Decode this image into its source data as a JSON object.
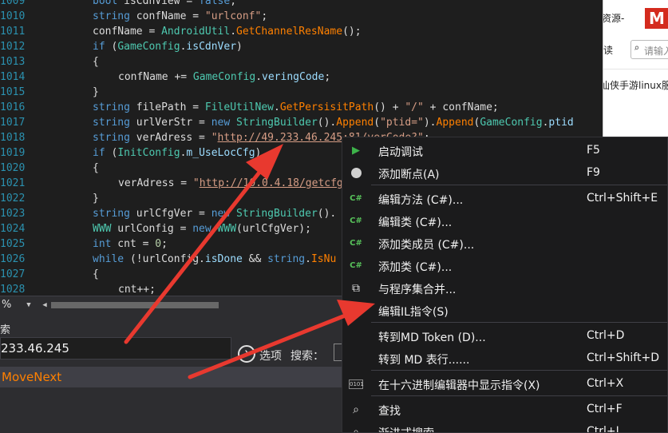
{
  "editor": {
    "lines": [
      {
        "n": "1009",
        "indent": 0,
        "tokens": [
          [
            "kw",
            "bool"
          ],
          [
            "tx",
            " isCdnView = "
          ],
          [
            "kw",
            "false"
          ],
          [
            "tx",
            ";"
          ]
        ]
      },
      {
        "n": "1010",
        "indent": 0,
        "tokens": [
          [
            "kw",
            "string"
          ],
          [
            "tx",
            " confName = "
          ],
          [
            "str",
            "\"urlconf\""
          ],
          [
            "tx",
            ";"
          ]
        ]
      },
      {
        "n": "1011",
        "indent": 0,
        "tokens": [
          [
            "tx",
            "confName = "
          ],
          [
            "ty",
            "AndroidUtil"
          ],
          [
            "tx",
            "."
          ],
          [
            "mt",
            "GetChannelResName"
          ],
          [
            "tx",
            "();"
          ]
        ]
      },
      {
        "n": "1012",
        "indent": 0,
        "tokens": [
          [
            "kw",
            "if"
          ],
          [
            "tx",
            " ("
          ],
          [
            "ty",
            "GameConfig"
          ],
          [
            "tx",
            "."
          ],
          [
            "fld",
            "isCdnVer"
          ],
          [
            "tx",
            ")"
          ]
        ]
      },
      {
        "n": "1013",
        "indent": 0,
        "tokens": [
          [
            "tx",
            "{"
          ]
        ]
      },
      {
        "n": "1014",
        "indent": 1,
        "tokens": [
          [
            "tx",
            "confName += "
          ],
          [
            "ty",
            "GameConfig"
          ],
          [
            "tx",
            "."
          ],
          [
            "fld",
            "veringCode"
          ],
          [
            "tx",
            ";"
          ]
        ]
      },
      {
        "n": "1015",
        "indent": 0,
        "tokens": [
          [
            "tx",
            "}"
          ]
        ]
      },
      {
        "n": "1016",
        "indent": 0,
        "tokens": [
          [
            "kw",
            "string"
          ],
          [
            "tx",
            " filePath = "
          ],
          [
            "ty",
            "FileUtilNew"
          ],
          [
            "tx",
            "."
          ],
          [
            "mt",
            "GetPersisitPath"
          ],
          [
            "tx",
            "() + "
          ],
          [
            "str",
            "\"/\""
          ],
          [
            "tx",
            " + confName;"
          ]
        ]
      },
      {
        "n": "1017",
        "indent": 0,
        "tokens": [
          [
            "kw",
            "string"
          ],
          [
            "tx",
            " urlVerStr = "
          ],
          [
            "kw",
            "new"
          ],
          [
            "tx",
            " "
          ],
          [
            "ty",
            "StringBuilder"
          ],
          [
            "tx",
            "()."
          ],
          [
            "mt",
            "Append"
          ],
          [
            "tx",
            "("
          ],
          [
            "str",
            "\"ptid=\""
          ],
          [
            "tx",
            ")."
          ],
          [
            "mt",
            "Append"
          ],
          [
            "tx",
            "("
          ],
          [
            "ty",
            "GameConfig"
          ],
          [
            "tx",
            "."
          ],
          [
            "fld",
            "ptid"
          ]
        ]
      },
      {
        "n": "1018",
        "indent": 0,
        "tokens": [
          [
            "kw",
            "string"
          ],
          [
            "tx",
            " verAdress = "
          ],
          [
            "str",
            "\""
          ],
          [
            "url",
            "http://49.233.46.245:81/verCode?"
          ],
          [
            "str",
            "\""
          ],
          [
            "tx",
            ";"
          ]
        ]
      },
      {
        "n": "1019",
        "indent": 0,
        "tokens": [
          [
            "kw",
            "if"
          ],
          [
            "tx",
            " ("
          ],
          [
            "ty",
            "InitConfig"
          ],
          [
            "tx",
            "."
          ],
          [
            "fld",
            "m_UseLocCfg"
          ],
          [
            "tx",
            ")"
          ]
        ]
      },
      {
        "n": "1020",
        "indent": 0,
        "tokens": [
          [
            "tx",
            "{"
          ]
        ]
      },
      {
        "n": "1021",
        "indent": 1,
        "tokens": [
          [
            "tx",
            "verAdress = "
          ],
          [
            "str",
            "\""
          ],
          [
            "url",
            "http://10.0.4.18/getcfg"
          ]
        ]
      },
      {
        "n": "1022",
        "indent": 0,
        "tokens": [
          [
            "tx",
            "}"
          ]
        ]
      },
      {
        "n": "1023",
        "indent": 0,
        "tokens": [
          [
            "kw",
            "string"
          ],
          [
            "tx",
            " urlCfgVer = "
          ],
          [
            "kw",
            "new"
          ],
          [
            "tx",
            " "
          ],
          [
            "ty",
            "StringBuilder"
          ],
          [
            "tx",
            "()."
          ]
        ]
      },
      {
        "n": "1024",
        "indent": 0,
        "tokens": [
          [
            "ty",
            "WWW"
          ],
          [
            "tx",
            " urlConfig = "
          ],
          [
            "kw",
            "new"
          ],
          [
            "tx",
            " "
          ],
          [
            "ty",
            "WWW"
          ],
          [
            "tx",
            "(urlCfgVer);"
          ]
        ]
      },
      {
        "n": "1025",
        "indent": 0,
        "tokens": [
          [
            "kw",
            "int"
          ],
          [
            "tx",
            " cnt = "
          ],
          [
            "num",
            "0"
          ],
          [
            "tx",
            ";"
          ]
        ]
      },
      {
        "n": "1026",
        "indent": 0,
        "tokens": [
          [
            "kw",
            "while"
          ],
          [
            "tx",
            " (!urlConfig."
          ],
          [
            "fld",
            "isDone"
          ],
          [
            "tx",
            " && "
          ],
          [
            "kw",
            "string"
          ],
          [
            "tx",
            "."
          ],
          [
            "mt",
            "IsNu"
          ]
        ]
      },
      {
        "n": "1027",
        "indent": 0,
        "tokens": [
          [
            "tx",
            "{"
          ]
        ]
      },
      {
        "n": "1028",
        "indent": 1,
        "tokens": [
          [
            "tx",
            "cnt++;"
          ]
        ]
      }
    ]
  },
  "browser": {
    "title_fragment": "资源-",
    "logo": "M",
    "read_label": "读",
    "search_placeholder": "请输入",
    "article_fragment": "仙侠手游linux服"
  },
  "scrollbar": {
    "zoom": "%"
  },
  "search": {
    "title": "索",
    "query": "233.46.245",
    "options_label": "选项",
    "search_type_label": "搜索：",
    "result": "MoveNext"
  },
  "context_menu": {
    "items": [
      {
        "icon": "play-icon",
        "label": "启动调试",
        "shortcut": "F5"
      },
      {
        "icon": "breakpoint-icon",
        "label": "添加断点(A)",
        "shortcut": "F9"
      },
      {
        "icon": "csharp-icon",
        "label": "编辑方法 (C#)...",
        "shortcut": "Ctrl+Shift+E"
      },
      {
        "icon": "csharp-icon",
        "label": "编辑类 (C#)...",
        "shortcut": ""
      },
      {
        "icon": "csharp-icon",
        "label": "添加类成员 (C#)...",
        "shortcut": ""
      },
      {
        "icon": "csharp-icon",
        "label": "添加类 (C#)...",
        "shortcut": ""
      },
      {
        "icon": "merge-icon",
        "label": "与程序集合并...",
        "shortcut": ""
      },
      {
        "icon": "il-edit-icon",
        "label": "编辑IL指令(S)",
        "shortcut": ""
      },
      {
        "icon": "",
        "label": "转到MD Token (D)...",
        "shortcut": "Ctrl+D"
      },
      {
        "icon": "",
        "label": "转到 MD 表行......",
        "shortcut": "Ctrl+Shift+D"
      },
      {
        "icon": "hex-icon",
        "label": "在十六进制编辑器中显示指令(X)",
        "shortcut": "Ctrl+X"
      },
      {
        "icon": "search-icon",
        "label": "查找",
        "shortcut": "Ctrl+F"
      },
      {
        "icon": "search-icon",
        "label": "渐进式搜索",
        "shortcut": "Ctrl+I"
      }
    ],
    "hex_icon_text": "0101"
  },
  "colors": {
    "editor_bg": "#1e1e1e",
    "line_number": "#2b91af",
    "keyword": "#569cd6",
    "type": "#4ec9b0",
    "method": "#ff8000",
    "string": "#d69d85",
    "menu_bg": "#1b1b1c",
    "annotation_arrow": "#e8392f"
  }
}
